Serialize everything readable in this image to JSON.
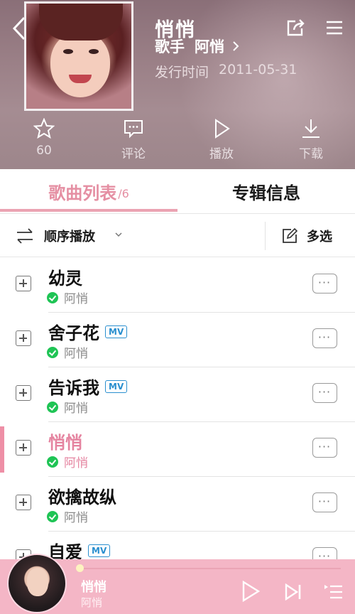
{
  "album": {
    "title": "悄悄",
    "singer_label": "歌手",
    "singer_name": "阿悄",
    "release_label": "发行时间",
    "release_date": "2011-05-31"
  },
  "actions": [
    {
      "label": "60",
      "icon": "star-icon"
    },
    {
      "label": "评论",
      "icon": "comment-icon"
    },
    {
      "label": "播放",
      "icon": "play-icon"
    },
    {
      "label": "下载",
      "icon": "download-icon"
    }
  ],
  "tabs": {
    "songs_label": "歌曲列表",
    "songs_count": "/6",
    "info_label": "专辑信息"
  },
  "toolbar": {
    "order_label": "顺序播放",
    "multi_label": "多选"
  },
  "songs": [
    {
      "title": "幼灵",
      "artist": "阿悄",
      "mv": false
    },
    {
      "title": "舍子花",
      "artist": "阿悄",
      "mv": true
    },
    {
      "title": "告诉我",
      "artist": "阿悄",
      "mv": true
    },
    {
      "title": "悄悄",
      "artist": "阿悄",
      "mv": false,
      "active": true
    },
    {
      "title": "欲擒故纵",
      "artist": "阿悄",
      "mv": false
    },
    {
      "title": "自爱",
      "artist": "",
      "mv": true
    }
  ],
  "mv_badge": "MV",
  "player": {
    "title": "悄悄",
    "artist": "阿悄",
    "progress": 0.01
  },
  "colors": {
    "accent": "#e584a0",
    "player_bg": "#f4b6c6",
    "check_green": "#1fc455",
    "mv_blue": "#2a8fcf"
  }
}
